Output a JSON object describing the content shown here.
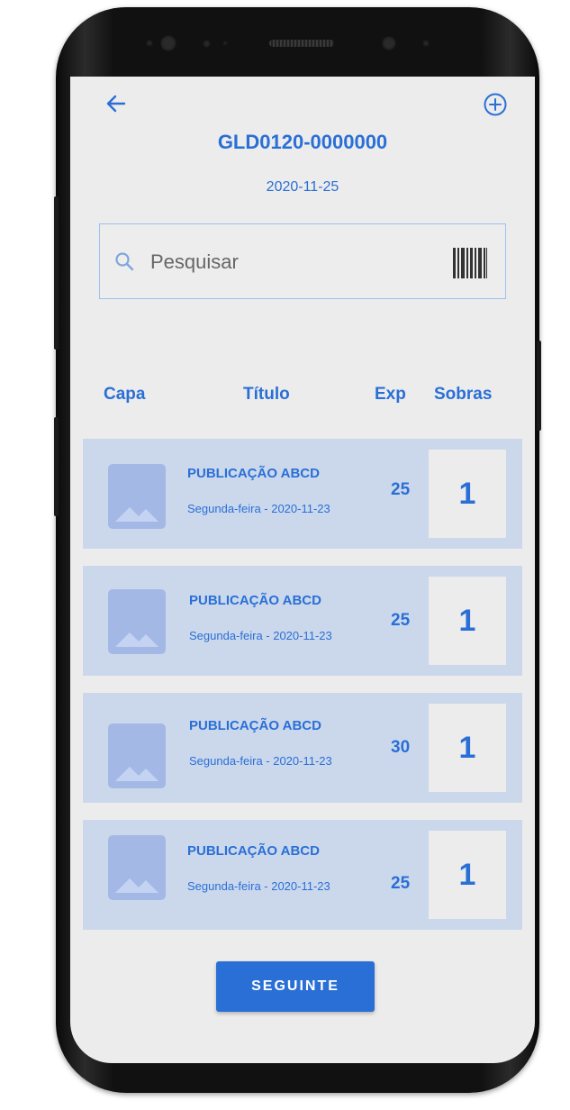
{
  "header": {
    "code": "GLD0120-0000000",
    "date": "2020-11-25",
    "back_icon": "arrow-left-icon",
    "add_icon": "plus-circle-icon"
  },
  "search": {
    "placeholder": "Pesquisar",
    "value": "",
    "search_icon": "search-icon",
    "barcode_icon": "barcode-icon"
  },
  "columns": {
    "capa": "Capa",
    "titulo": "Título",
    "exp": "Exp",
    "sobras": "Sobras"
  },
  "items": [
    {
      "title": "PUBLICAÇÃO ABCD",
      "subtitle": "Segunda-feira - 2020-11-23",
      "exp": "25",
      "sobras": "1"
    },
    {
      "title": "PUBLICAÇÃO ABCD",
      "subtitle": "Segunda-feira - 2020-11-23",
      "exp": "25",
      "sobras": "1"
    },
    {
      "title": "PUBLICAÇÃO ABCD",
      "subtitle": "Segunda-feira - 2020-11-23",
      "exp": "30",
      "sobras": "1"
    },
    {
      "title": "PUBLICAÇÃO ABCD",
      "subtitle": "Segunda-feira - 2020-11-23",
      "exp": "25",
      "sobras": "1"
    }
  ],
  "footer": {
    "next_label": "SEGUINTE"
  },
  "colors": {
    "accent": "#2a6fd6",
    "row_background": "#cbd8ec",
    "thumbnail": "#a4b8e6",
    "screen_background": "#ececec"
  }
}
